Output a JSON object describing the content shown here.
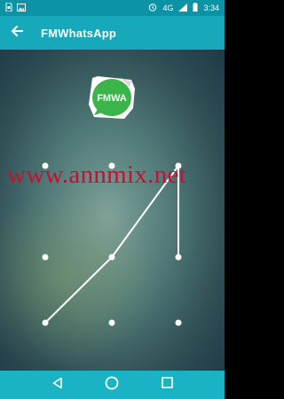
{
  "status_bar": {
    "left_icons": [
      "sim-icon",
      "image-icon"
    ],
    "right_icons": [
      "alarm-icon",
      "wifi-icon",
      "signal-icon",
      "battery-icon"
    ],
    "network": "4G",
    "time": "3:34"
  },
  "app_bar": {
    "back_icon": "arrow-back-icon",
    "title": "FMWhatsApp"
  },
  "logo": {
    "text": "FMWA",
    "color": "#3bb54a"
  },
  "watermark": {
    "text": "www.annmix.net",
    "color": "#c8102e"
  },
  "pattern": {
    "grid": [
      3,
      3
    ],
    "path_nodes": [
      6,
      4,
      2,
      5
    ]
  },
  "nav_bar": {
    "icons": [
      "back-triangle-icon",
      "home-circle-icon",
      "recents-square-icon"
    ]
  },
  "colors": {
    "status_bar": "#0c93a5",
    "app_bar": "#17a9bb",
    "nav_bar": "#1ab3c6"
  }
}
